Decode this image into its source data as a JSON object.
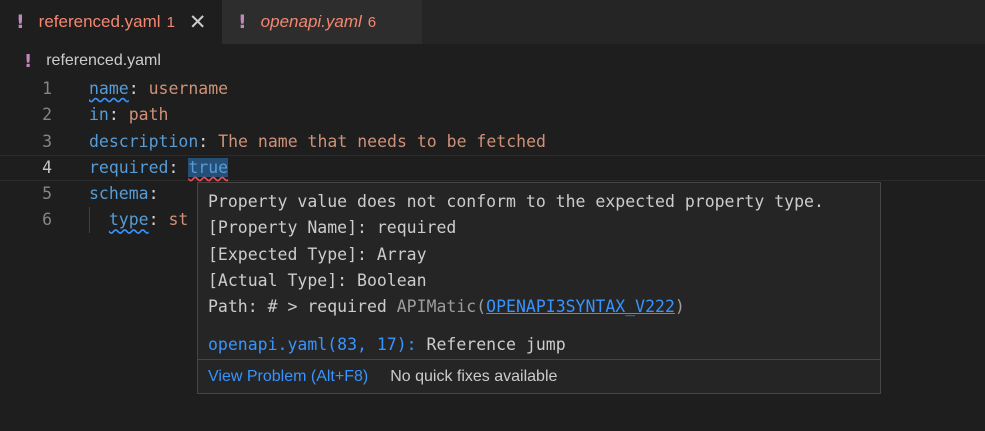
{
  "tabs": [
    {
      "icon": "!",
      "name": "referenced.yaml",
      "count": "1",
      "close": "✕",
      "active": true
    },
    {
      "icon": "!",
      "name": "openapi.yaml",
      "count": "6",
      "active": false
    }
  ],
  "breadcrumb": {
    "icon": "!",
    "file": "referenced.yaml"
  },
  "editor": {
    "lines": [
      {
        "num": "1",
        "key": "name",
        "sep": ": ",
        "value": "username"
      },
      {
        "num": "2",
        "key": "in",
        "sep": ": ",
        "value": "path"
      },
      {
        "num": "3",
        "key": "description",
        "sep": ": ",
        "value": "The name that needs to be fetched"
      },
      {
        "num": "4",
        "key": "required",
        "sep": ": ",
        "value": "true"
      },
      {
        "num": "5",
        "key": "schema",
        "sep": ":",
        "value": ""
      },
      {
        "num": "6",
        "key": "type",
        "sep": ": ",
        "value": "st"
      }
    ]
  },
  "hover": {
    "message": "Property value does not conform to the expected property type.",
    "property_name": "[Property Name]: required",
    "expected_type": "[Expected Type]: Array",
    "actual_type": "[Actual Type]: Boolean",
    "path": "Path: # > required",
    "source": "APIMatic(",
    "code": "OPENAPI3SYNTAX_V222",
    "source_end": ")",
    "reference_location": "openapi.yaml(83, 17):",
    "reference_text": " Reference jump",
    "view_problem": "View Problem (Alt+F8)",
    "no_fixes": "No quick fixes available"
  },
  "colors": {
    "error": "#f48771",
    "keyword": "#569cd6",
    "string": "#ce9178",
    "link": "#3794ff",
    "warning_icon": "#c586c0"
  }
}
